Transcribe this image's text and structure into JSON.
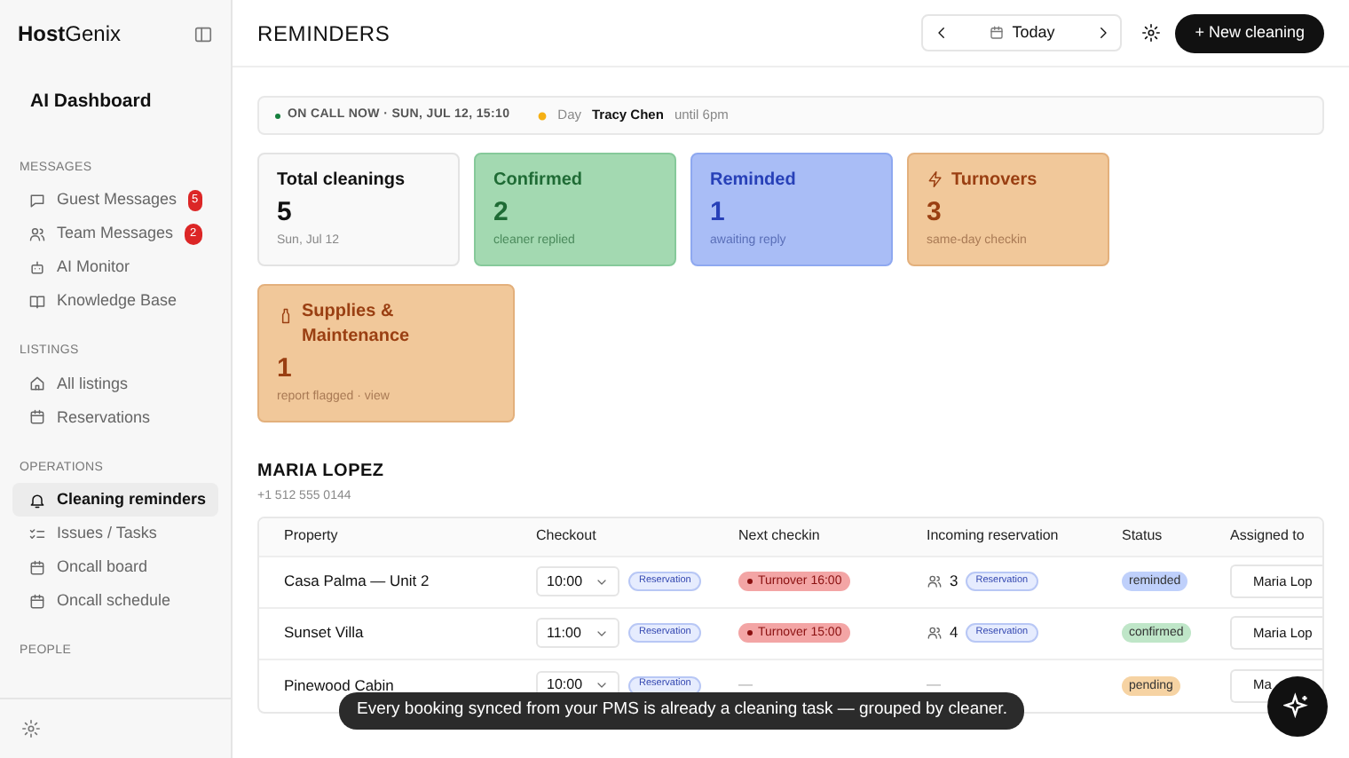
{
  "sidebar": {
    "logo_bold": "Host",
    "logo_light": "Genix",
    "dashboard": "AI Dashboard",
    "sections": [
      {
        "title": "MESSAGES",
        "items": [
          {
            "label": "Guest Messages",
            "badge": "5",
            "selected": false
          },
          {
            "label": "Team Messages",
            "badge": "2",
            "selected": false
          },
          {
            "label": "AI Monitor",
            "selected": false
          },
          {
            "label": "Knowledge Base",
            "selected": false
          }
        ]
      },
      {
        "title": "LISTINGS",
        "items": [
          {
            "label": "All listings",
            "selected": false
          },
          {
            "label": "Reservations",
            "selected": false
          }
        ]
      },
      {
        "title": "OPERATIONS",
        "items": [
          {
            "label": "Cleaning reminders",
            "selected": true
          },
          {
            "label": "Issues / Tasks",
            "selected": false
          },
          {
            "label": "Oncall board",
            "selected": false
          },
          {
            "label": "Oncall schedule",
            "selected": false
          }
        ]
      },
      {
        "title": "PEOPLE"
      }
    ]
  },
  "header": {
    "title": "REMINDERS",
    "date_button": "Today",
    "new_button": "+ New cleaning"
  },
  "oncall": {
    "label": "ON CALL NOW · SUN, JUL 12, 15:10",
    "shift": "Day",
    "name": "Tracy Chen",
    "until": "until 6pm"
  },
  "cards": [
    {
      "kind": "neutral",
      "title": "Total cleanings",
      "value": "5",
      "note": "Sun, Jul 12"
    },
    {
      "kind": "green",
      "title": "Confirmed",
      "value": "2",
      "note": "cleaner replied"
    },
    {
      "kind": "blue",
      "title": "Reminded",
      "value": "1",
      "note": "awaiting reply"
    },
    {
      "kind": "orange",
      "title": "Turnovers",
      "value": "3",
      "note": "same-day checkin"
    },
    {
      "kind": "orange",
      "title": "Supplies & Maintenance",
      "value": "1",
      "note": "report flagged · view"
    }
  ],
  "group": {
    "cleaner": "MARIA LOPEZ",
    "phone": "+1 512 555 0144",
    "columns": [
      "Property",
      "Checkout",
      "Next checkin",
      "Incoming reservation",
      "Status",
      "Assigned to"
    ],
    "rows": [
      {
        "property": "Casa Palma — Unit 2",
        "checkout": "10:00",
        "checkout_tag": "Reservation",
        "next_checkin": "Turnover 16:00",
        "guests": "3",
        "incoming_tag": "Reservation",
        "status": "reminded",
        "color": "#bfd0fb",
        "assigned": "Maria Lop"
      },
      {
        "property": "Sunset Villa",
        "checkout": "11:00",
        "checkout_tag": "Reservation",
        "next_checkin": "Turnover 15:00",
        "guests": "4",
        "incoming_tag": "Reservation",
        "status": "confirmed",
        "color": "#bfe6c8",
        "assigned": "Maria Lop"
      },
      {
        "property": "Pinewood Cabin",
        "checkout": "10:00",
        "checkout_tag": "Reservation",
        "next_checkin_empty": "—",
        "incoming_empty": "—",
        "status": "pending",
        "color": "#f6d3a3",
        "assigned": "Ma"
      }
    ]
  },
  "toast": "Every booking synced from your PMS is already a cleaning task — grouped by cleaner."
}
